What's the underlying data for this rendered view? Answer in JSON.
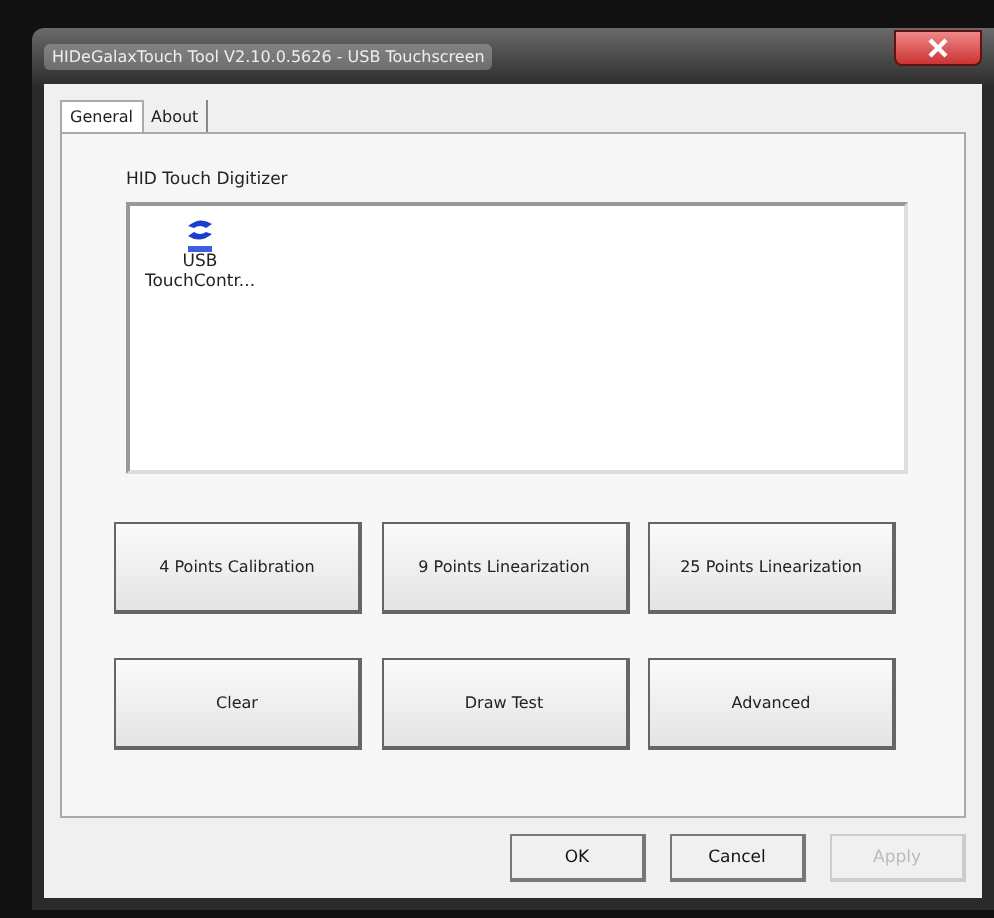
{
  "window": {
    "title": "HIDeGalaxTouch Tool V2.10.0.5626 - USB Touchscreen"
  },
  "tabs": [
    {
      "label": "General",
      "selected": true
    },
    {
      "label": "About",
      "selected": false
    }
  ],
  "group": {
    "label": "HID Touch Digitizer",
    "devices": [
      {
        "label": "USB TouchContr...",
        "selected": false
      }
    ]
  },
  "actions": [
    {
      "label": "4 Points Calibration"
    },
    {
      "label": "9 Points Linearization"
    },
    {
      "label": "25 Points Linearization"
    },
    {
      "label": "Clear"
    },
    {
      "label": "Draw Test"
    },
    {
      "label": "Advanced"
    }
  ],
  "dialog_buttons": [
    {
      "label": "OK",
      "disabled": false
    },
    {
      "label": "Cancel",
      "disabled": false
    },
    {
      "label": "Apply",
      "disabled": true
    }
  ]
}
